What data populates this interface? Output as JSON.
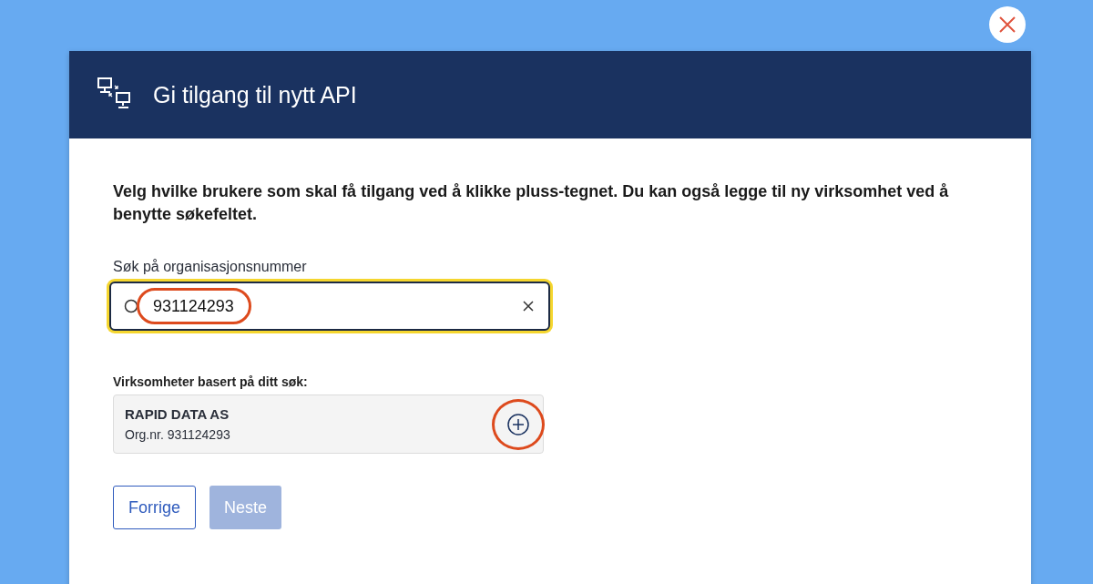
{
  "dialog": {
    "title": "Gi tilgang til nytt API"
  },
  "intro": "Velg hvilke brukere som skal få tilgang ved å klikke pluss-tegnet. Du kan også legge til ny virksomhet ved å benytte søkefeltet.",
  "search": {
    "label": "Søk på organisasjonsnummer",
    "value": "931124293",
    "highlighted": true
  },
  "results": {
    "label": "Virksomheter basert på ditt søk:",
    "items": [
      {
        "name": "RAPID DATA AS",
        "org": "Org.nr. 931124293",
        "highlighted": true
      }
    ]
  },
  "buttons": [
    {
      "label": "Forrige",
      "kind": "secondary",
      "disabled": false
    },
    {
      "label": "Neste",
      "kind": "primary",
      "disabled": true
    }
  ]
}
